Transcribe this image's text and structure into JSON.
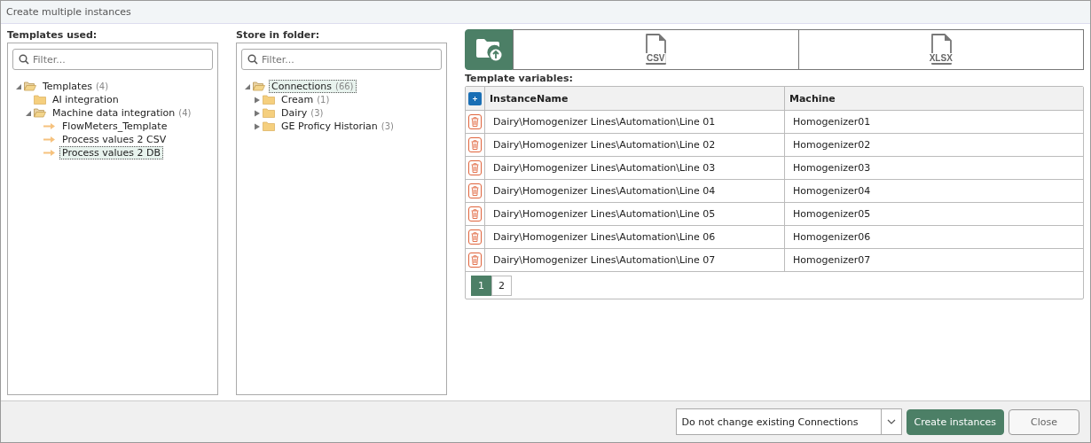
{
  "window": {
    "title": "Create multiple instances"
  },
  "templates_panel": {
    "label": "Templates used:",
    "filter": {
      "placeholder": "Filter..."
    },
    "tree": [
      {
        "kind": "folder",
        "label": "Templates",
        "count": "(4)",
        "expanded": true,
        "selected": false,
        "children": [
          {
            "kind": "folder",
            "label": "AI integration",
            "selected": false
          },
          {
            "kind": "folder",
            "label": "Machine data integration",
            "count": "(4)",
            "expanded": true,
            "selected": false,
            "children": [
              {
                "kind": "template",
                "label": "FlowMeters_Template",
                "selected": false
              },
              {
                "kind": "template",
                "label": "Process values 2 CSV",
                "selected": false
              },
              {
                "kind": "template",
                "label": "Process values 2 DB",
                "selected": true
              }
            ]
          }
        ]
      }
    ]
  },
  "folder_panel": {
    "label": "Store in folder:",
    "filter": {
      "placeholder": "Filter..."
    },
    "tree": [
      {
        "kind": "folder",
        "label": "Connections",
        "count": "(66)",
        "expanded": true,
        "selected": true,
        "children": [
          {
            "kind": "folder",
            "label": "Cream",
            "count": "(1)",
            "expanded": false,
            "selected": false
          },
          {
            "kind": "folder",
            "label": "Dairy",
            "count": "(3)",
            "expanded": false,
            "selected": false
          },
          {
            "kind": "folder",
            "label": "GE Proficy Historian",
            "count": "(3)",
            "expanded": false,
            "selected": false
          }
        ]
      }
    ]
  },
  "source_tabs": [
    {
      "kind": "folder",
      "selected": true
    },
    {
      "kind": "file",
      "label": "CSV",
      "selected": false
    },
    {
      "kind": "file",
      "label": "XLSX",
      "selected": false
    }
  ],
  "variables": {
    "label": "Template variables:",
    "columns": [
      "InstanceName",
      "Machine"
    ],
    "rows": [
      [
        "Dairy\\Homogenizer Lines\\Automation\\Line 01",
        "Homogenizer01"
      ],
      [
        "Dairy\\Homogenizer Lines\\Automation\\Line 02",
        "Homogenizer02"
      ],
      [
        "Dairy\\Homogenizer Lines\\Automation\\Line 03",
        "Homogenizer03"
      ],
      [
        "Dairy\\Homogenizer Lines\\Automation\\Line 04",
        "Homogenizer04"
      ],
      [
        "Dairy\\Homogenizer Lines\\Automation\\Line 05",
        "Homogenizer05"
      ],
      [
        "Dairy\\Homogenizer Lines\\Automation\\Line 06",
        "Homogenizer06"
      ],
      [
        "Dairy\\Homogenizer Lines\\Automation\\Line 07",
        "Homogenizer07"
      ]
    ],
    "pages": [
      {
        "label": "1",
        "selected": true
      },
      {
        "label": "2",
        "selected": false
      }
    ]
  },
  "footer": {
    "mode": "Do not change existing Connections",
    "buttons": [
      {
        "label": "Create instances",
        "kind": "primary"
      },
      {
        "label": "Close",
        "kind": "secondary"
      }
    ]
  }
}
